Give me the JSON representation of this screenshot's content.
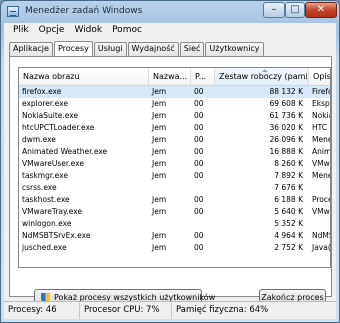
{
  "window": {
    "title": "Menedżer zadań Windows",
    "min_label": "–",
    "max_label": "□",
    "close_label": "✕"
  },
  "menu": [
    "Plik",
    "Opcje",
    "Widok",
    "Pomoc"
  ],
  "tabs": [
    "Aplikacje",
    "Procesy",
    "Usługi",
    "Wydajność",
    "Sieć",
    "Użytkownicy"
  ],
  "active_tab": "Procesy",
  "columns": [
    "Nazwa obrazu",
    "Nazwa...",
    "P...",
    "Zestaw roboczy (pamięć)",
    "Opis"
  ],
  "sorted_column": "Zestaw roboczy (pamięć)",
  "processes": [
    {
      "name": "firefox.exe",
      "user": "Jem",
      "cpu": "00",
      "memory": "88 132 K",
      "desc": "Firefox",
      "selected": true
    },
    {
      "name": "explorer.exe",
      "user": "Jem",
      "cpu": "00",
      "memory": "69 608 K",
      "desc": "Eksploi"
    },
    {
      "name": "NokiaSuite.exe",
      "user": "Jem",
      "cpu": "00",
      "memory": "61 736 K",
      "desc": "Nokia S"
    },
    {
      "name": "htcUPCTLoader.exe",
      "user": "Jem",
      "cpu": "00",
      "memory": "36 020 K",
      "desc": "HTC U"
    },
    {
      "name": "dwm.exe",
      "user": "Jem",
      "cpu": "00",
      "memory": "26 096 K",
      "desc": "Menedż"
    },
    {
      "name": "Animated Weather.exe",
      "user": "Jem",
      "cpu": "00",
      "memory": "16 888 K",
      "desc": "Animat"
    },
    {
      "name": "VMwareUser.exe",
      "user": "Jem",
      "cpu": "00",
      "memory": "8 260 K",
      "desc": "VMwar"
    },
    {
      "name": "taskmgr.exe",
      "user": "Jem",
      "cpu": "00",
      "memory": "7 892 K",
      "desc": "Menedż"
    },
    {
      "name": "csrss.exe",
      "user": "",
      "cpu": "",
      "memory": "7 676 K",
      "desc": ""
    },
    {
      "name": "taskhost.exe",
      "user": "Jem",
      "cpu": "00",
      "memory": "6 188 K",
      "desc": "Proces"
    },
    {
      "name": "VMwareTray.exe",
      "user": "Jem",
      "cpu": "00",
      "memory": "5 640 K",
      "desc": "VMwar"
    },
    {
      "name": "winlogon.exe",
      "user": "",
      "cpu": "",
      "memory": "5 352 K",
      "desc": ""
    },
    {
      "name": "NdMSBTSrvEx.exe",
      "user": "Jem",
      "cpu": "00",
      "memory": "4 964 K",
      "desc": "NdMSB"
    },
    {
      "name": "jusched.exe",
      "user": "Jem",
      "cpu": "00",
      "memory": "2 752 K",
      "desc": "Java(TN"
    }
  ],
  "buttons": {
    "show_all": "Pokaż procesy wszystkich użytkowników",
    "end_process": "Zakończ proces"
  },
  "status": {
    "processes": "Procesy: 46",
    "cpu": "Procesor CPU: 7%",
    "memory": "Pamięć fizyczna: 64%"
  },
  "colors": {
    "selection": "#d7e8f8",
    "close_button": "#c4432a",
    "titlebar": "#a4c1e0"
  }
}
